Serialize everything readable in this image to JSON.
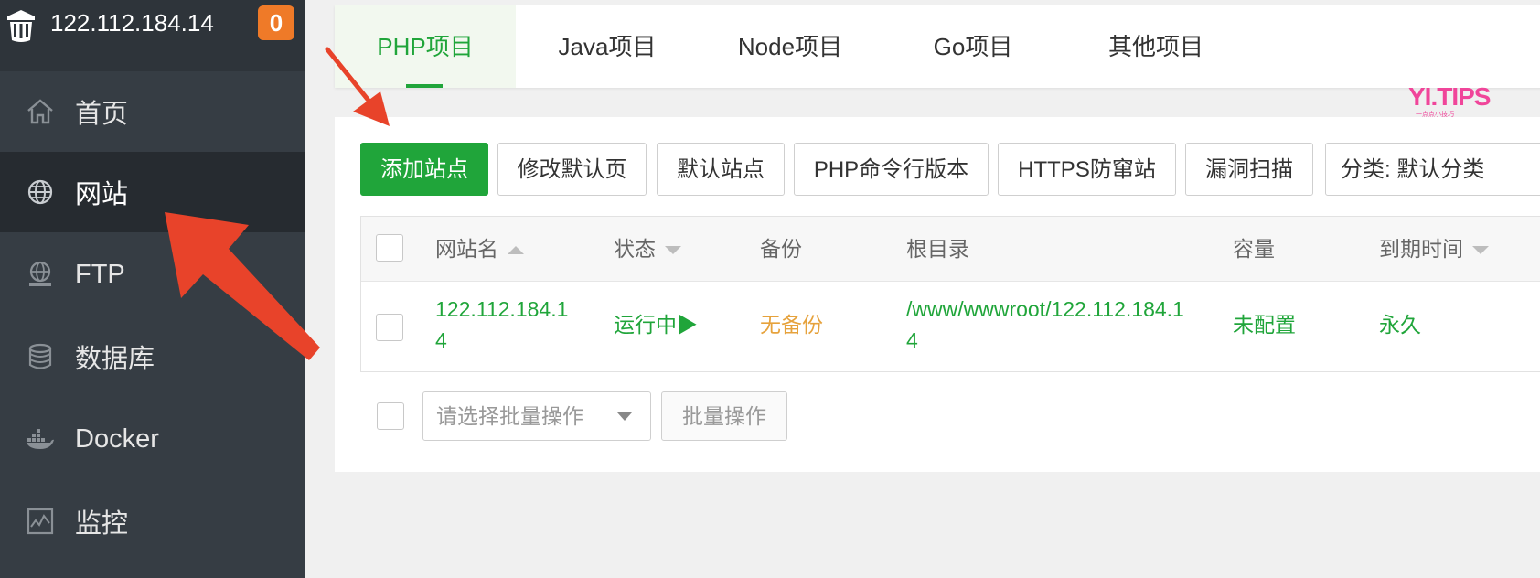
{
  "sidebar": {
    "server_ip": "122.112.184.14",
    "alert_count": "0",
    "items": [
      {
        "label": "首页",
        "icon": "home-icon"
      },
      {
        "label": "网站",
        "icon": "globe-icon",
        "active": true
      },
      {
        "label": "FTP",
        "icon": "ftp-icon"
      },
      {
        "label": "数据库",
        "icon": "database-icon"
      },
      {
        "label": "Docker",
        "icon": "docker-icon"
      },
      {
        "label": "监控",
        "icon": "monitor-icon"
      }
    ]
  },
  "tabs": [
    {
      "label": "PHP项目",
      "active": true
    },
    {
      "label": "Java项目"
    },
    {
      "label": "Node项目"
    },
    {
      "label": "Go项目"
    },
    {
      "label": "其他项目"
    }
  ],
  "watermark": {
    "text": "YI.TIPS",
    "sub": "一点点小技巧"
  },
  "toolbar": {
    "add_site": "添加站点",
    "edit_default_page": "修改默认页",
    "default_site": "默认站点",
    "php_cli_version": "PHP命令行版本",
    "https_anti_hijack": "HTTPS防窜站",
    "vuln_scan": "漏洞扫描",
    "category_select": "分类: 默认分类"
  },
  "table": {
    "headers": {
      "name": "网站名",
      "status": "状态",
      "backup": "备份",
      "root": "根目录",
      "capacity": "容量",
      "expiry": "到期时间"
    },
    "rows": [
      {
        "name_line1": "122.112.184.1",
        "name_line2": "4",
        "status": "运行中▶",
        "backup": "无备份",
        "root_line1": "/www/wwwroot/122.112.184.1",
        "root_line2": "4",
        "capacity": "未配置",
        "expiry": "永久"
      }
    ]
  },
  "batch": {
    "select_placeholder": "请选择批量操作",
    "button": "批量操作"
  },
  "colors": {
    "sidebar_bg": "#363d44",
    "accent_green": "#20a53a",
    "badge_orange": "#ef7a28",
    "annotation_red": "#e8432a",
    "backup_orange": "#e6a23c"
  }
}
